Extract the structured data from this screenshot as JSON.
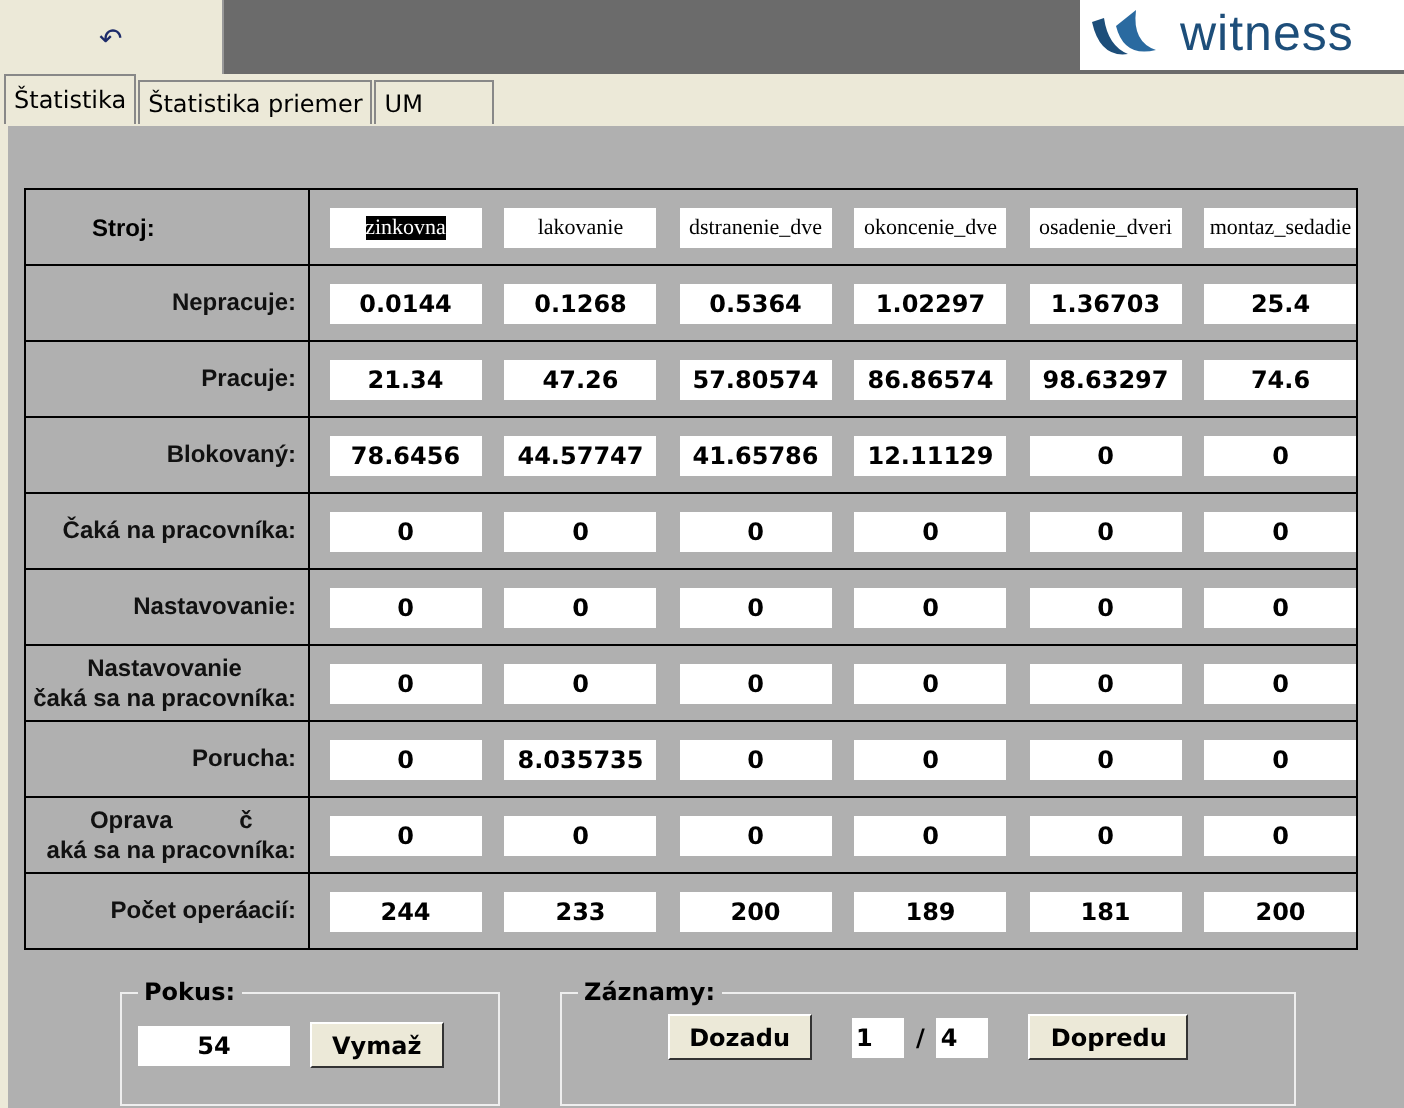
{
  "toolbar": {
    "undo_button": "↶"
  },
  "logo": {
    "text": "witness"
  },
  "tabs": [
    {
      "label": "Štatistika",
      "selected": true
    },
    {
      "label": "Štatistika priemer",
      "selected": false
    },
    {
      "label": "UM",
      "selected": false
    }
  ],
  "machines": [
    {
      "name": "zinkovna",
      "selected": true
    },
    {
      "name": "lakovanie",
      "selected": false
    },
    {
      "name": "dstranenie_dve",
      "selected": false
    },
    {
      "name": "okoncenie_dve",
      "selected": false
    },
    {
      "name": "osadenie_dveri",
      "selected": false
    },
    {
      "name": "montaz_sedadie",
      "selected": false
    }
  ],
  "machine_label": "Stroj:",
  "rows": [
    {
      "label": [
        "Nepracuje:"
      ],
      "values": [
        "0.0144",
        "0.1268",
        "0.5364",
        "1.02297",
        "1.36703",
        "25.4"
      ]
    },
    {
      "label": [
        "Pracuje:"
      ],
      "values": [
        "21.34",
        "47.26",
        "57.80574",
        "86.86574",
        "98.63297",
        "74.6"
      ]
    },
    {
      "label": [
        "Blokovaný:"
      ],
      "values": [
        "78.6456",
        "44.57747",
        "41.65786",
        "12.11129",
        "0",
        "0"
      ]
    },
    {
      "label": [
        "Čaká na pracovníka:"
      ],
      "values": [
        "0",
        "0",
        "0",
        "0",
        "0",
        "0"
      ]
    },
    {
      "label": [
        "Nastavovanie:"
      ],
      "values": [
        "0",
        "0",
        "0",
        "0",
        "0",
        "0"
      ]
    },
    {
      "label": [
        "Nastavovanie",
        "čaká sa na pracovníka:"
      ],
      "values": [
        "0",
        "0",
        "0",
        "0",
        "0",
        "0"
      ]
    },
    {
      "label": [
        "Porucha:"
      ],
      "values": [
        "0",
        "8.035735",
        "0",
        "0",
        "0",
        "0"
      ]
    },
    {
      "label": [
        "Oprava          č",
        "aká sa na pracovníka:"
      ],
      "values": [
        "0",
        "0",
        "0",
        "0",
        "0",
        "0"
      ]
    },
    {
      "label": [
        "Počet operáacií:"
      ],
      "values": [
        "244",
        "233",
        "200",
        "189",
        "181",
        "200"
      ]
    }
  ],
  "pokus": {
    "legend": "Pokus:",
    "value": "54",
    "button": "Vymaž"
  },
  "zaznamy": {
    "legend": "Záznamy:",
    "back_button": "Dozadu",
    "current": "1",
    "separator": "/",
    "total": "4",
    "forward_button": "Dopredu"
  }
}
